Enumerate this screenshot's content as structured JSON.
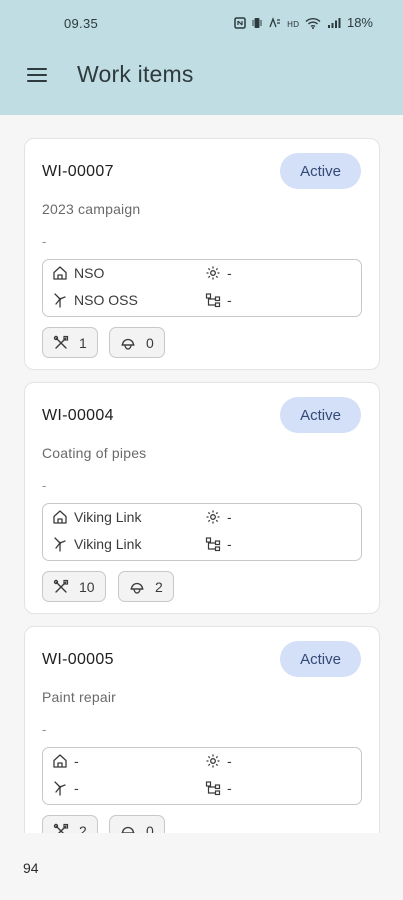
{
  "status": {
    "time": "09.35",
    "battery": "18%"
  },
  "appbar": {
    "title": "Work items"
  },
  "items": [
    {
      "id": "WI-00007",
      "status": "Active",
      "title": "2023 campaign",
      "description": "-",
      "site": "NSO",
      "location": "NSO OSS",
      "equipment": "-",
      "structure": "-",
      "task_count": "1",
      "personnel_count": "0"
    },
    {
      "id": "WI-00004",
      "status": "Active",
      "title": "Coating of pipes",
      "description": "-",
      "site": "Viking Link",
      "location": "Viking Link",
      "equipment": "-",
      "structure": "-",
      "task_count": "10",
      "personnel_count": "2"
    },
    {
      "id": "WI-00005",
      "status": "Active",
      "title": "Paint repair",
      "description": "-",
      "site": "-",
      "location": "-",
      "equipment": "-",
      "structure": "-",
      "task_count": "2",
      "personnel_count": "0"
    }
  ],
  "footer": {
    "count": "94"
  },
  "colors": {
    "header_bg": "#bfdde3",
    "badge_bg": "#d4e0f8",
    "badge_text": "#334a76",
    "card_bg": "#ffffff",
    "page_bg": "#f6f6f6"
  },
  "icons": {
    "site": "home-icon",
    "location": "windmill-icon",
    "equipment": "gear-icon",
    "structure": "hierarchy-icon",
    "tasks": "tools-icon",
    "personnel": "helmet-icon",
    "menu": "hamburger-menu-icon"
  }
}
